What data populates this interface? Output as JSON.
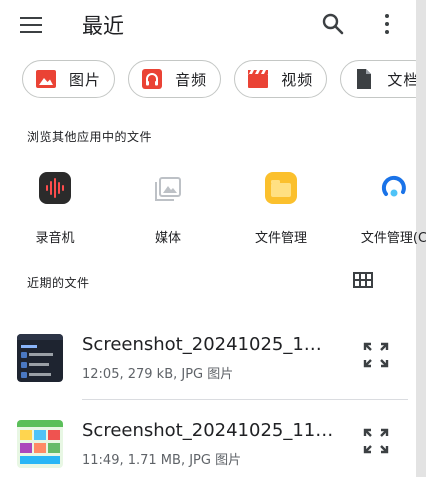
{
  "appbar": {
    "title": "最近",
    "icons": [
      "menu-icon",
      "search-icon",
      "more-vert-icon"
    ]
  },
  "chips": [
    {
      "label": "图片",
      "icon": "image-icon",
      "color": "#ea4335"
    },
    {
      "label": "音频",
      "icon": "headphones-icon",
      "color": "#ea4335"
    },
    {
      "label": "视频",
      "icon": "movie-clapper-icon",
      "color": "#ea4335"
    },
    {
      "label": "文档",
      "icon": "document-icon",
      "color": "#3c4043"
    }
  ],
  "browse_section": {
    "label": "浏览其他应用中的文件",
    "apps": [
      {
        "label": "录音机",
        "icon": "voice-recorder-icon"
      },
      {
        "label": "媒体",
        "icon": "media-icon"
      },
      {
        "label": "文件管理",
        "icon": "file-manager-folder-icon"
      },
      {
        "label": "文件管理(C",
        "icon": "file-manager-c-icon"
      }
    ]
  },
  "recent_section": {
    "label": "近期的文件",
    "view_toggle_icon": "grid-view-icon"
  },
  "files": [
    {
      "name": "Screenshot_20241025_1…",
      "meta": "12:05, 279 kB, JPG 图片",
      "thumbnail": "dark-screenshot-thumbnail"
    },
    {
      "name": "Screenshot_20241025_11…",
      "meta": "11:49, 1.71 MB, JPG 图片",
      "thumbnail": "colorful-screenshot-thumbnail"
    }
  ],
  "colors": {
    "accent_red": "#ea4335",
    "text_primary": "#202124",
    "text_secondary": "#5f6368",
    "outline": "#c4c7c5",
    "folder_yellow": "#fbc02d",
    "blue": "#1a73e8"
  }
}
